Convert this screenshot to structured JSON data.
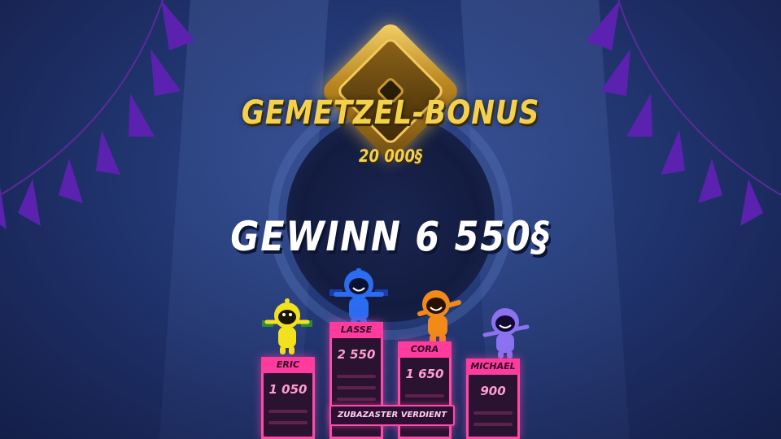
{
  "bonus": {
    "title": "GEMETZEL-BONUS",
    "amount": "20 000§"
  },
  "win": {
    "label": "GEWINN 6 550§"
  },
  "players": [
    {
      "name": "ERIC",
      "score": "1 050",
      "color": "#f2e21d"
    },
    {
      "name": "LASSE",
      "score": "2 550",
      "color": "#2b6cf0"
    },
    {
      "name": "CORA",
      "score": "1 650",
      "color": "#f28a1a"
    },
    {
      "name": "MICHAEL",
      "score": "900",
      "color": "#8a72f0"
    }
  ],
  "footer": {
    "earned_label": "ZUBAZASTER VERDIENT"
  },
  "colors": {
    "gold": "#f4d14c",
    "neon_pink": "#ff4aa6",
    "background": "#243a78"
  }
}
